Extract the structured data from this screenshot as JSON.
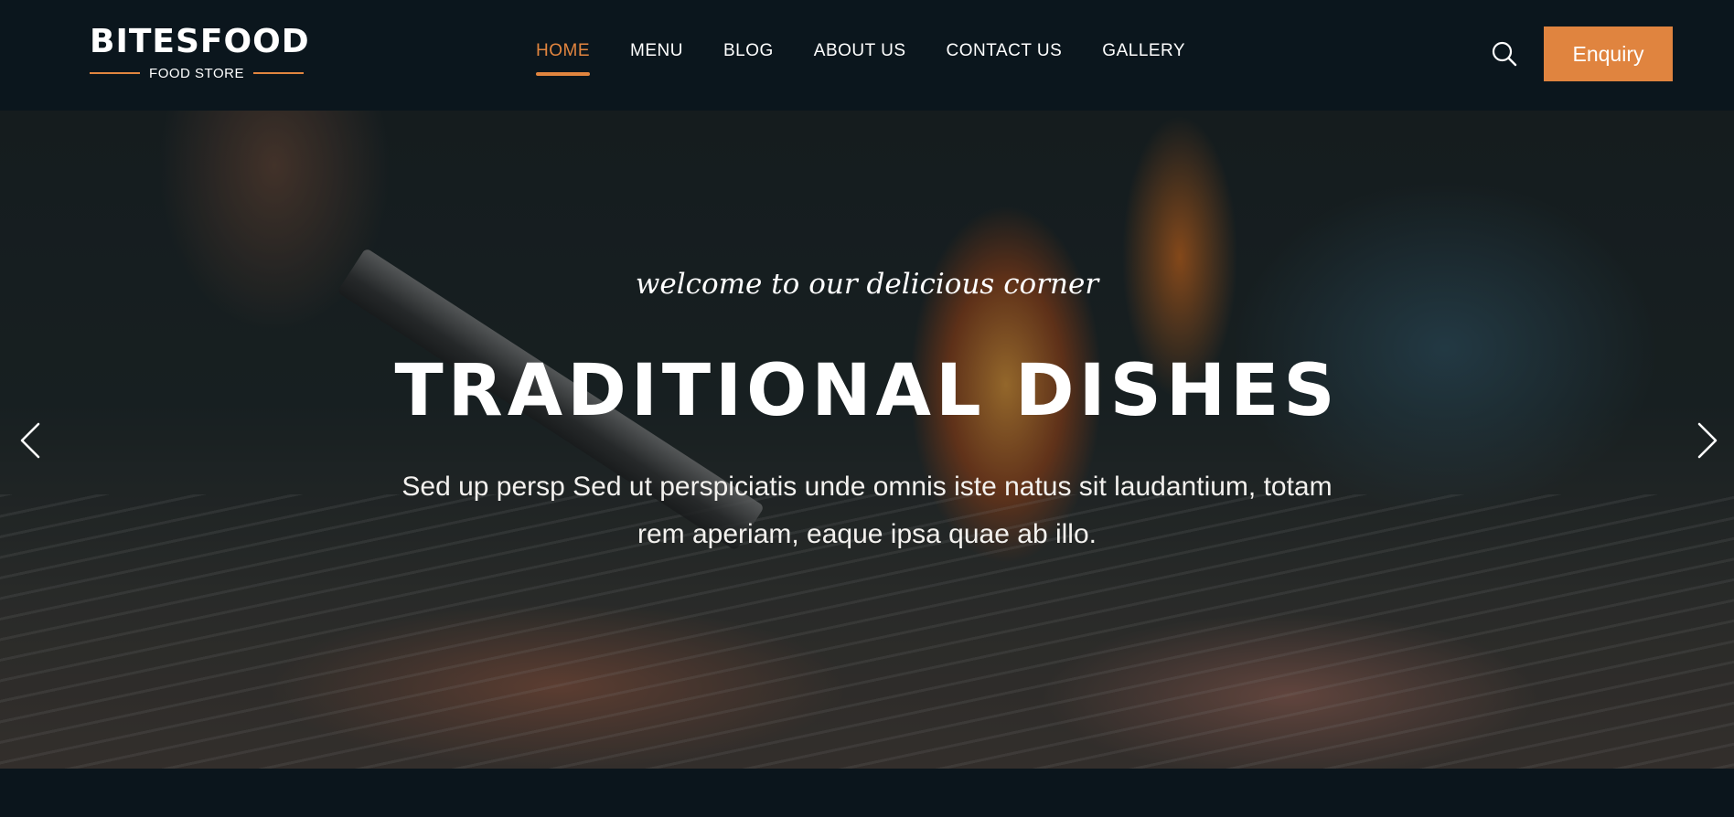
{
  "brand": {
    "name": "BITESFOOD",
    "tagline": "FOOD STORE",
    "accent_color": "#e2853f",
    "header_bg": "#0b161d"
  },
  "nav": {
    "items": [
      {
        "label": "HOME",
        "active": true
      },
      {
        "label": "MENU",
        "active": false
      },
      {
        "label": "BLOG",
        "active": false
      },
      {
        "label": "ABOUT US",
        "active": false
      },
      {
        "label": "CONTACT US",
        "active": false
      },
      {
        "label": "GALLERY",
        "active": false
      }
    ]
  },
  "header_actions": {
    "search_icon": "search-icon",
    "enquiry_label": "Enquiry"
  },
  "hero": {
    "script_text": "welcome to our delicious corner",
    "title": "TRADITIONAL DISHES",
    "description": "Sed up persp Sed ut perspiciatis unde omnis iste natus sit laudantium, totam rem aperiam, eaque ipsa quae ab illo.",
    "prev_icon": "chevron-left-icon",
    "next_icon": "chevron-right-icon"
  }
}
